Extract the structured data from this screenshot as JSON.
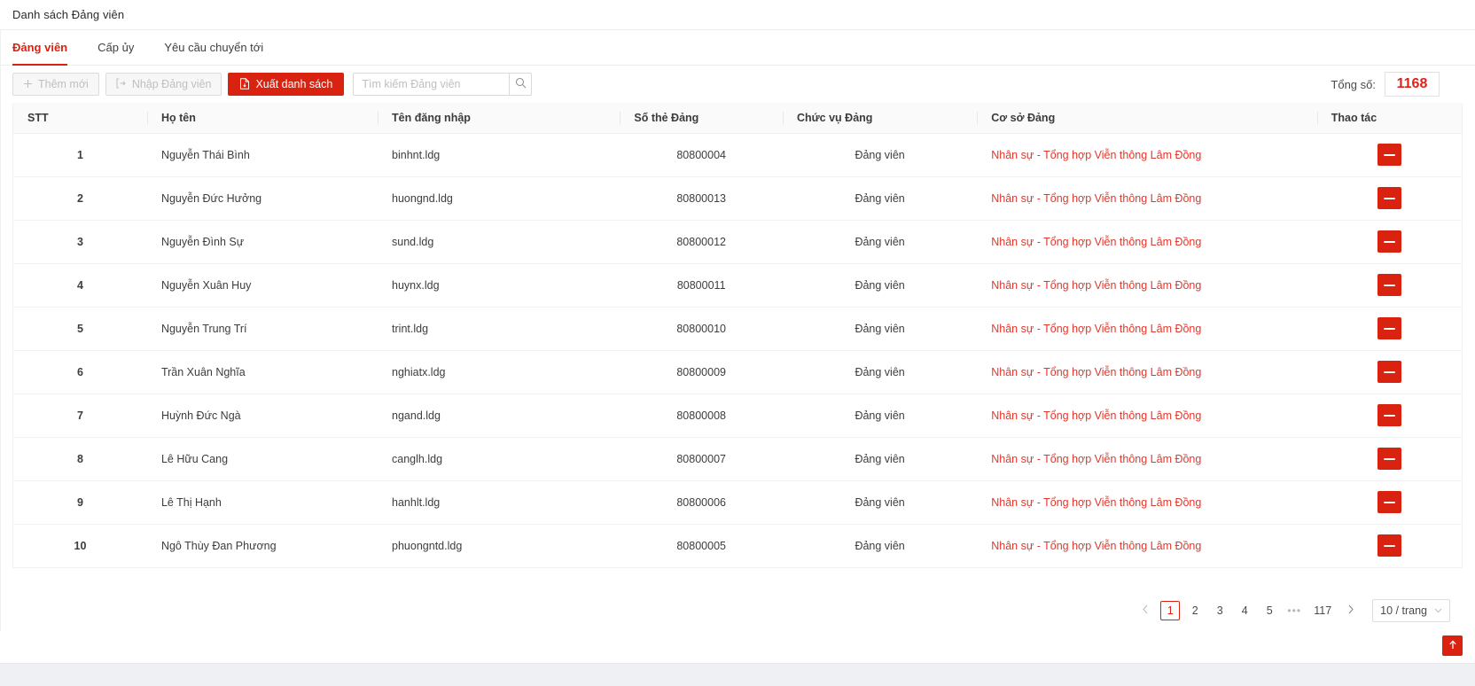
{
  "header": {
    "title": "Danh sách Đảng viên"
  },
  "tabs": [
    {
      "label": "Đảng viên",
      "active": true
    },
    {
      "label": "Cấp ủy",
      "active": false
    },
    {
      "label": "Yêu cầu chuyển tới",
      "active": false
    }
  ],
  "toolbar": {
    "add_label": "Thêm mới",
    "add_icon": "plus-icon",
    "import_label": "Nhập Đảng viên",
    "import_icon": "import-icon",
    "export_label": "Xuất danh sách",
    "export_icon": "file-export-icon",
    "search_placeholder": "Tìm kiếm Đảng viên",
    "search_value": "",
    "search_icon": "search-icon",
    "total_label": "Tổng số:",
    "total_value": "1168",
    "total_color": "#e0231a",
    "accent_color": "#d9220f"
  },
  "table": {
    "columns": [
      {
        "key": "stt",
        "label": "STT"
      },
      {
        "key": "name",
        "label": "Họ tên"
      },
      {
        "key": "username",
        "label": "Tên đăng nhập"
      },
      {
        "key": "card",
        "label": "Số thẻ Đảng"
      },
      {
        "key": "role",
        "label": "Chức vụ Đảng"
      },
      {
        "key": "org",
        "label": "Cơ sở Đảng"
      },
      {
        "key": "action",
        "label": "Thao tác"
      }
    ],
    "action_icon": "menu-hamburger-icon",
    "rows": [
      {
        "stt": "1",
        "name": "Nguyễn Thái Bình",
        "username": "binhnt.ldg",
        "card": "80800004",
        "role": "Đảng viên",
        "org": "Nhân sự - Tổng hợp Viễn thông Lâm Đồng"
      },
      {
        "stt": "2",
        "name": "Nguyễn Đức Hưởng",
        "username": "huongnd.ldg",
        "card": "80800013",
        "role": "Đảng viên",
        "org": "Nhân sự - Tổng hợp Viễn thông Lâm Đồng"
      },
      {
        "stt": "3",
        "name": "Nguyễn Đình Sự",
        "username": "sund.ldg",
        "card": "80800012",
        "role": "Đảng viên",
        "org": "Nhân sự - Tổng hợp Viễn thông Lâm Đồng"
      },
      {
        "stt": "4",
        "name": "Nguyễn Xuân Huy",
        "username": "huynx.ldg",
        "card": "80800011",
        "role": "Đảng viên",
        "org": "Nhân sự - Tổng hợp Viễn thông Lâm Đồng"
      },
      {
        "stt": "5",
        "name": "Nguyễn Trung Trí",
        "username": "trint.ldg",
        "card": "80800010",
        "role": "Đảng viên",
        "org": "Nhân sự - Tổng hợp Viễn thông Lâm Đồng"
      },
      {
        "stt": "6",
        "name": "Trần Xuân Nghĩa",
        "username": "nghiatx.ldg",
        "card": "80800009",
        "role": "Đảng viên",
        "org": "Nhân sự - Tổng hợp Viễn thông Lâm Đồng"
      },
      {
        "stt": "7",
        "name": "Huỳnh Đức Ngà",
        "username": "ngand.ldg",
        "card": "80800008",
        "role": "Đảng viên",
        "org": "Nhân sự - Tổng hợp Viễn thông Lâm Đồng"
      },
      {
        "stt": "8",
        "name": "Lê Hữu Cang",
        "username": "canglh.ldg",
        "card": "80800007",
        "role": "Đảng viên",
        "org": "Nhân sự - Tổng hợp Viễn thông Lâm Đồng"
      },
      {
        "stt": "9",
        "name": "Lê Thị Hạnh",
        "username": "hanhlt.ldg",
        "card": "80800006",
        "role": "Đảng viên",
        "org": "Nhân sự - Tổng hợp Viễn thông Lâm Đồng"
      },
      {
        "stt": "10",
        "name": "Ngô Thùy Đan Phương",
        "username": "phuongntd.ldg",
        "card": "80800005",
        "role": "Đảng viên",
        "org": "Nhân sự - Tổng hợp Viễn thông Lâm Đồng"
      }
    ]
  },
  "pagination": {
    "prev_icon": "chevron-left-icon",
    "next_icon": "chevron-right-icon",
    "pages": [
      "1",
      "2",
      "3",
      "4",
      "5"
    ],
    "ellipsis": "•••",
    "last_page": "117",
    "current": "1",
    "page_size_label": "10 / trang",
    "page_size_chevron": "chevron-down-icon"
  },
  "back_to_top": {
    "icon": "arrow-up-icon",
    "label": "↑"
  }
}
